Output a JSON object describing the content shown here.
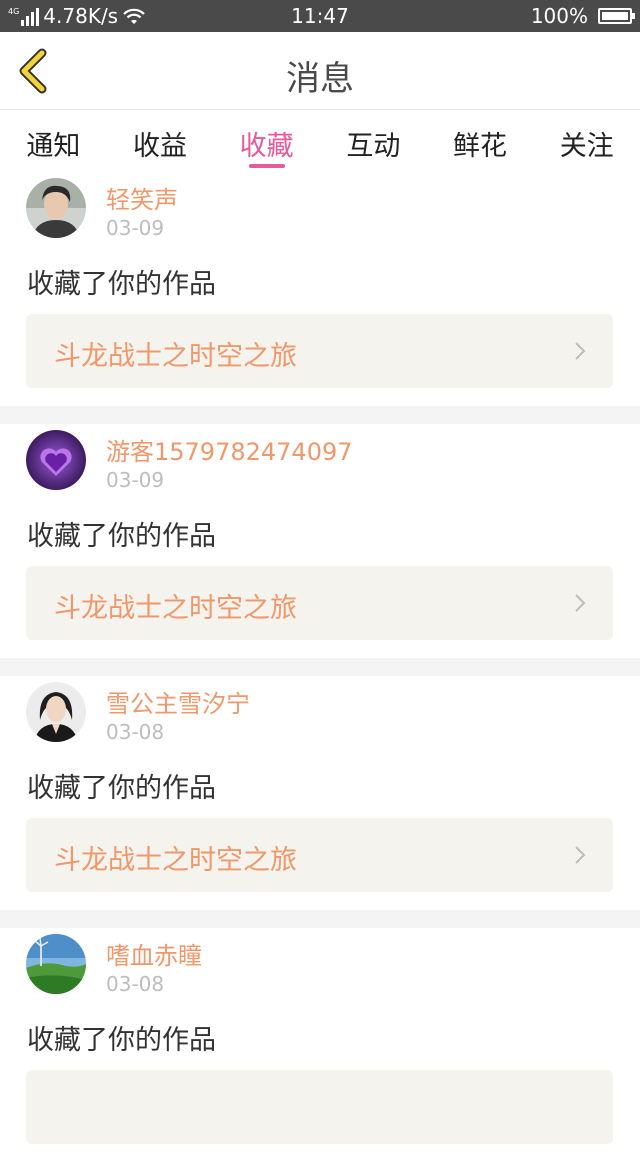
{
  "status_bar": {
    "signal_label": "4G",
    "network_speed": "4.78K/s",
    "time": "11:47",
    "battery": "100%"
  },
  "header": {
    "title": "消息",
    "back_icon": "chevron-left-icon"
  },
  "tabs": [
    {
      "label": "通知",
      "active": false
    },
    {
      "label": "收益",
      "active": false
    },
    {
      "label": "收藏",
      "active": true
    },
    {
      "label": "互动",
      "active": false
    },
    {
      "label": "鲜花",
      "active": false
    },
    {
      "label": "关注",
      "active": false
    }
  ],
  "colors": {
    "accent": "#e6599a",
    "orange_text": "#f0986a",
    "card_bg": "#f4f3ee",
    "gray_text": "#bdbdbd"
  },
  "messages": [
    {
      "username": "轻笑声",
      "date": "03-09",
      "action": "收藏了你的作品",
      "work_title": "斗龙战士之时空之旅",
      "avatar": "portrait-man-avatar"
    },
    {
      "username": "游客1579782474097",
      "date": "03-09",
      "action": "收藏了你的作品",
      "work_title": "斗龙战士之时空之旅",
      "avatar": "purple-heart-avatar"
    },
    {
      "username": "雪公主雪汐宁",
      "date": "03-08",
      "action": "收藏了你的作品",
      "work_title": "斗龙战士之时空之旅",
      "avatar": "portrait-woman-avatar"
    },
    {
      "username": "嗜血赤瞳",
      "date": "03-08",
      "action": "收藏了你的作品",
      "work_title": "",
      "avatar": "landscape-avatar"
    }
  ]
}
